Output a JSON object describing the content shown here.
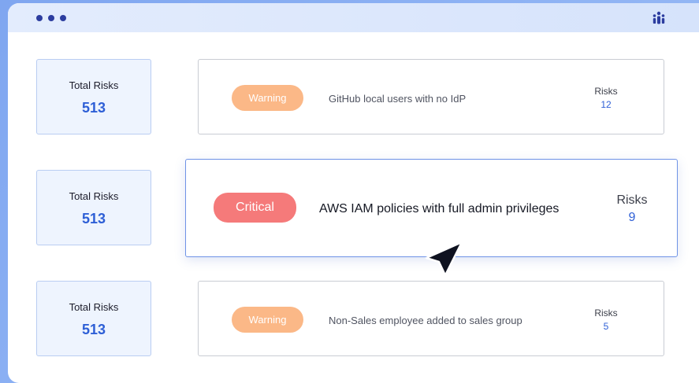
{
  "window": {
    "controls": [
      "dot",
      "dot",
      "dot"
    ],
    "brand_icon": "people-group-icon",
    "accent_color": "#2e5fd6"
  },
  "stats": [
    {
      "label": "Total Risks",
      "value": "513"
    },
    {
      "label": "Total Risks",
      "value": "513"
    },
    {
      "label": "Total Risks",
      "value": "513"
    }
  ],
  "risks": [
    {
      "severity": "Warning",
      "description": "GitHub local users with no IdP",
      "count_label": "Risks",
      "count": "12",
      "severity_color": "#fbb887"
    },
    {
      "severity": "Critical",
      "description": "AWS IAM policies with full admin privileges",
      "count_label": "Risks",
      "count": "9",
      "severity_color": "#f57a7a"
    },
    {
      "severity": "Warning",
      "description": "Non-Sales employee added to sales group",
      "count_label": "Risks",
      "count": "5",
      "severity_color": "#fbb887"
    }
  ]
}
